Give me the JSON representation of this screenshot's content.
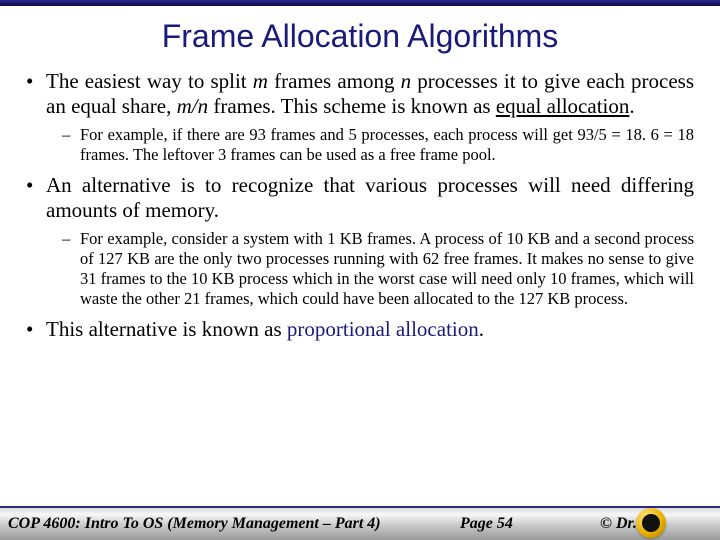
{
  "title": "Frame Allocation Algorithms",
  "bullets": {
    "b1_pre": "The easiest way to split ",
    "b1_m": "m",
    "b1_mid1": " frames among ",
    "b1_n": "n",
    "b1_mid2": " processes it to give each process an equal share, ",
    "b1_mn": "m/n",
    "b1_mid3": " frames.  This scheme is known as ",
    "b1_term": "equal allocation",
    "b1_end": ".",
    "b1_sub": "For example, if there are 93 frames and 5 processes, each process will get 93/5 = 18. 6 = 18 frames.  The leftover 3 frames can be used as a free frame pool.",
    "b2": "An alternative is to recognize that various processes will need differing amounts of memory.",
    "b2_sub": "For example, consider a system with 1 KB frames.  A process of 10 KB and a second process of 127 KB are the only two processes running with 62 free frames.  It makes no sense to give 31 frames to the 10 KB process which in the worst case will need only 10 frames, which will waste the other 21 frames, which could have been allocated to the 127 KB process.",
    "b3_pre": "This alternative is known as ",
    "b3_term": "proportional allocation",
    "b3_end": "."
  },
  "footer": {
    "course": "COP 4600: Intro To OS  (Memory Management – Part 4)",
    "page": "Page 54",
    "copyright": "© Dr."
  }
}
